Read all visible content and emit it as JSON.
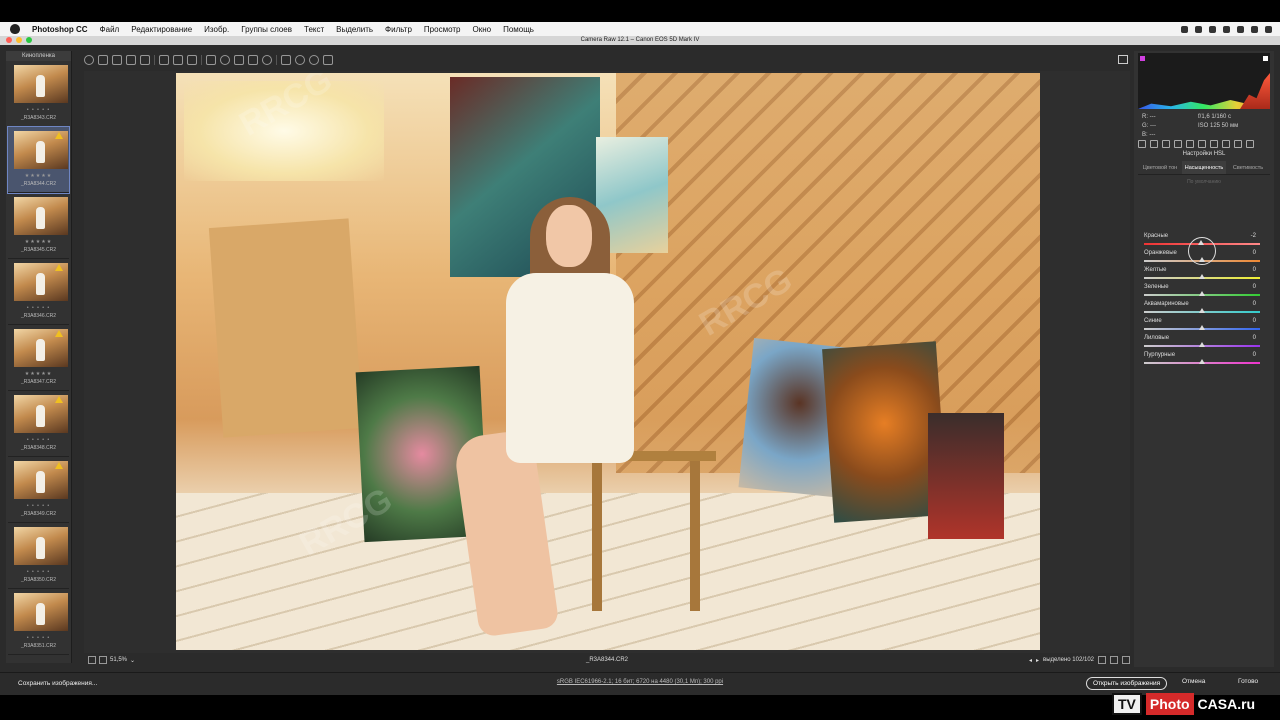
{
  "menubar": {
    "app": "Photoshop CC",
    "items": [
      "Файл",
      "Редактирование",
      "Изобр.",
      "Группы слоев",
      "Текст",
      "Выделить",
      "Фильтр",
      "Просмотр",
      "Окно",
      "Помощь"
    ]
  },
  "window": {
    "title": "Camera Raw 12.1 – Canon EOS 5D Mark IV"
  },
  "filmstrip": {
    "title": "Кинопленка",
    "items": [
      {
        "name": "_R3A8343.CR2",
        "stars": "• • • • •",
        "warning": false,
        "selected": false
      },
      {
        "name": "_R3A8344.CR2",
        "stars": "★★★★★",
        "warning": true,
        "selected": true
      },
      {
        "name": "_R3A8345.CR2",
        "stars": "★★★★★",
        "warning": false,
        "selected": false
      },
      {
        "name": "_R3A8346.CR2",
        "stars": "• • • • •",
        "warning": true,
        "selected": false
      },
      {
        "name": "_R3A8347.CR2",
        "stars": "★★★★★",
        "warning": true,
        "selected": false
      },
      {
        "name": "_R3A8348.CR2",
        "stars": "• • • • •",
        "warning": true,
        "selected": false
      },
      {
        "name": "_R3A8349.CR2",
        "stars": "• • • • •",
        "warning": true,
        "selected": false
      },
      {
        "name": "_R3A8350.CR2",
        "stars": "• • • • •",
        "warning": false,
        "selected": false
      },
      {
        "name": "_R3A8351.CR2",
        "stars": "• • • • •",
        "warning": false,
        "selected": false
      }
    ]
  },
  "canvas": {
    "zoom": "51,5%",
    "filename": "_R3A8344.CR2",
    "selected_count": "выделено 102/102"
  },
  "info": {
    "r": "R:   ---",
    "g": "G:   ---",
    "b": "B:   ---",
    "aperture_shutter": "f/1,6    1/160 с",
    "iso_focal": "ISO 125    50 мм"
  },
  "panel": {
    "heading": "Настройки HSL",
    "tabs": [
      "Цветовой тон",
      "Насыщенность",
      "Светимость"
    ],
    "active_tab": 1,
    "default_label": "По умолчанию",
    "sliders": [
      {
        "label": "Красные",
        "value": "-2",
        "level": -2,
        "color_from": "#e33",
        "color_to": "#f88"
      },
      {
        "label": "Оранжевые",
        "value": "0",
        "level": 0,
        "color_from": "#ccc",
        "color_to": "#e83"
      },
      {
        "label": "Желтые",
        "value": "0",
        "level": 0,
        "color_from": "#ccc",
        "color_to": "#ee3"
      },
      {
        "label": "Зеленые",
        "value": "0",
        "level": 0,
        "color_from": "#ccc",
        "color_to": "#3c3"
      },
      {
        "label": "Аквамариновые",
        "value": "0",
        "level": 0,
        "color_from": "#ccc",
        "color_to": "#3cc"
      },
      {
        "label": "Синие",
        "value": "0",
        "level": 0,
        "color_from": "#ccc",
        "color_to": "#36e"
      },
      {
        "label": "Лиловые",
        "value": "0",
        "level": 0,
        "color_from": "#ccc",
        "color_to": "#93e"
      },
      {
        "label": "Пурпурные",
        "value": "0",
        "level": 0,
        "color_from": "#ccc",
        "color_to": "#e3c"
      }
    ]
  },
  "bottombar": {
    "save_label": "Сохранить изображения...",
    "workflow": "sRGB IEC61966-2.1; 16 бит; 6720 на 4480 (30,1 Мп); 300 ppi",
    "open_label": "Открыть изображения",
    "cancel_label": "Отмена",
    "done_label": "Готово"
  },
  "logo": {
    "tv": "TV",
    "photo": "Photo",
    "casa": "CASA.ru"
  },
  "watermark_text": "RRCG",
  "colors": {
    "accent": "#6f86c4",
    "warning": "#f0c020",
    "panel_bg": "#323232"
  }
}
